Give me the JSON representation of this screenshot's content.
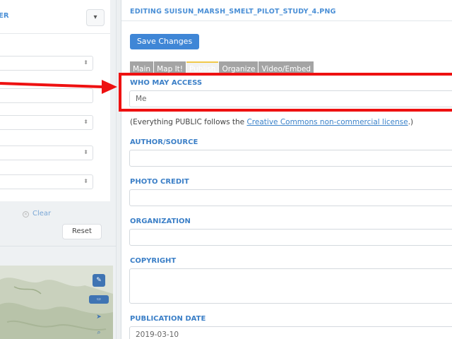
{
  "sidebar": {
    "heading_fragment": "ER",
    "clear_label": "Clear",
    "reset_label": "Reset"
  },
  "editor": {
    "title": "EDITING SUISUN_MARSH_SMELT_PILOT_STUDY_4.PNG",
    "save_label": "Save Changes",
    "tabs": [
      {
        "label": "Main"
      },
      {
        "label": "Map It!"
      },
      {
        "label": "Publish"
      },
      {
        "label": "Organize"
      },
      {
        "label": "Video/Embed"
      }
    ],
    "who_may_access": {
      "label": "WHO MAY ACCESS",
      "value": "Me"
    },
    "license_note": {
      "prefix": "(Everything PUBLIC follows the ",
      "link": "Creative Commons non-commercial license",
      "suffix": ".)"
    },
    "author_source": {
      "label": "AUTHOR/SOURCE",
      "value": ""
    },
    "photo_credit": {
      "label": "PHOTO CREDIT",
      "value": ""
    },
    "organization": {
      "label": "ORGANIZATION",
      "value": ""
    },
    "copyright": {
      "label": "COPYRIGHT",
      "value": ""
    },
    "publication_date": {
      "label": "PUBLICATION DATE",
      "value": "2019-03-10"
    }
  },
  "colors": {
    "accent": "#3f86d6",
    "label_blue": "#3b7fc7",
    "annotation_red": "#ee1111",
    "active_tab_border": "#f0c94a"
  }
}
